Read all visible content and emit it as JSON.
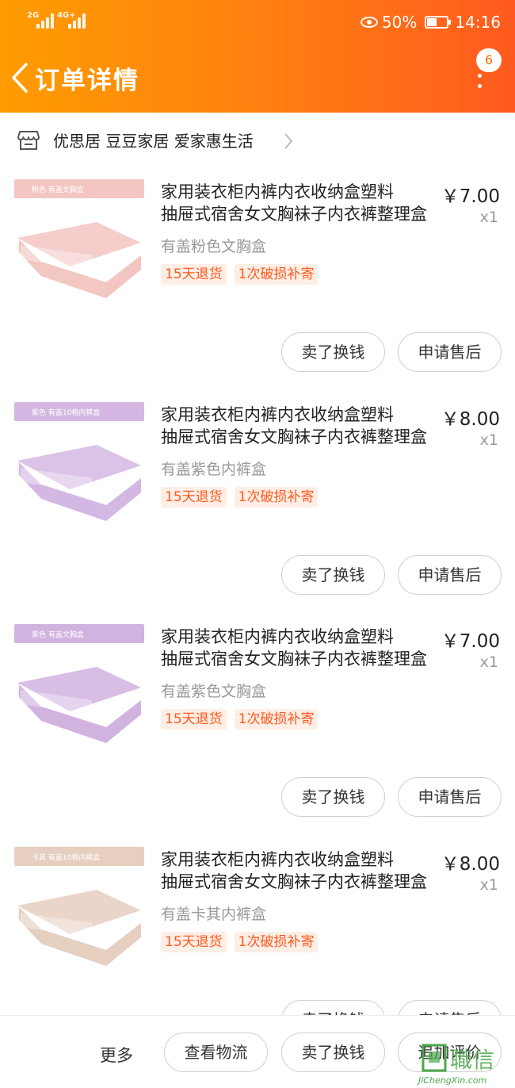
{
  "status": {
    "left_signal_1": "2G",
    "left_signal_2": "4G+",
    "battery_percent": "50%",
    "time": "14:16"
  },
  "header": {
    "title": "订单详情",
    "badge_count": "6"
  },
  "shop": {
    "name": "优思居 豆豆家居 爱家惠生活"
  },
  "items": [
    {
      "image_tag": "粉色 有盖文胸盒",
      "title_line1": "家用装衣柜内裤内衣收纳盒塑料",
      "title_line2": "抽屉式宿舍女文胸袜子内衣裤整理盒",
      "price": "￥7.00",
      "qty": "x1",
      "spec": "有盖粉色文胸盒",
      "service_1": "15天退货",
      "service_2": "1次破损补寄",
      "btn_exchange": "卖了换钱",
      "btn_aftersale": "申请售后",
      "color": "#f3c6c2"
    },
    {
      "image_tag": "紫色 有盖10格内裤盒",
      "title_line1": "家用装衣柜内裤内衣收纳盒塑料",
      "title_line2": "抽屉式宿舍女文胸袜子内衣裤整理盒",
      "price": "￥8.00",
      "qty": "x1",
      "spec": "有盖紫色内裤盒",
      "service_1": "15天退货",
      "service_2": "1次破损补寄",
      "btn_exchange": "卖了换钱",
      "btn_aftersale": "申请售后",
      "color": "#d4b8e3"
    },
    {
      "image_tag": "紫色 有盖文胸盒",
      "title_line1": "家用装衣柜内裤内衣收纳盒塑料",
      "title_line2": "抽屉式宿舍女文胸袜子内衣裤整理盒",
      "price": "￥7.00",
      "qty": "x1",
      "spec": "有盖紫色文胸盒",
      "service_1": "15天退货",
      "service_2": "1次破损补寄",
      "btn_exchange": "卖了换钱",
      "btn_aftersale": "申请售后",
      "color": "#d1b3e0"
    },
    {
      "image_tag": "卡其 有盖10格内裤盒",
      "title_line1": "家用装衣柜内裤内衣收纳盒塑料",
      "title_line2": "抽屉式宿舍女文胸袜子内衣裤整理盒",
      "price": "￥8.00",
      "qty": "x1",
      "spec": "有盖卡其内裤盒",
      "service_1": "15天退货",
      "service_2": "1次破损补寄",
      "btn_exchange": "卖了换钱",
      "btn_aftersale": "申请售后",
      "color": "#e6cfc0"
    }
  ],
  "bottom_bar": {
    "more": "更多",
    "logistics": "查看物流",
    "exchange": "卖了换钱",
    "add_review": "追加评价"
  },
  "watermark": {
    "text": "JiChengXin.com",
    "logo_text": "職信"
  },
  "colors": {
    "header_start": "#ff9c00",
    "header_end": "#ff5a1f",
    "accent": "#ff5a1f"
  }
}
